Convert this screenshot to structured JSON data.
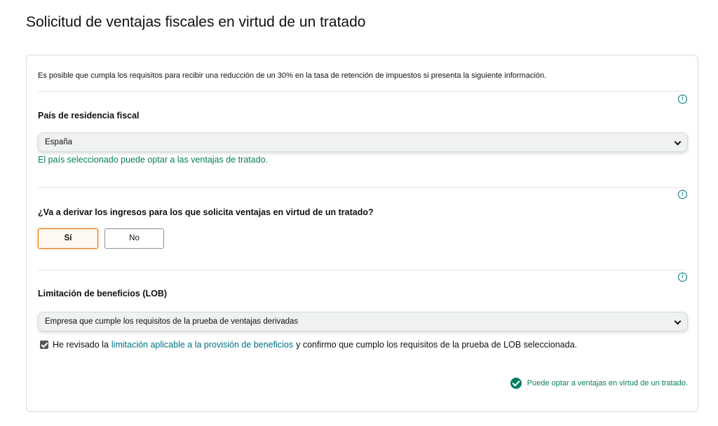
{
  "page": {
    "title": "Solicitud de ventajas fiscales en virtud de un tratado"
  },
  "card": {
    "intro": "Es posible que cumpla los requisitos para recibir una reducción de un 30% en la tasa de retención de impuestos si presenta la siguiente información."
  },
  "residence": {
    "label": "País de residencia fiscal",
    "selected": "España",
    "message": "El país seleccionado puede optar a las ventajas de tratado."
  },
  "derive": {
    "label": "¿Va a derivar los ingresos para los que solicita ventajas en virtud de un tratado?",
    "yes_label": "Sí",
    "no_label": "No",
    "selected": "Sí"
  },
  "lob": {
    "label": "Limitación de beneficios (LOB)",
    "selected": "Empresa que cumple los requisitos de la prueba de ventajas derivadas",
    "checkbox_checked": true,
    "checkbox_prefix": "He revisado la",
    "checkbox_link": "limitación aplicable a la provisión de beneficios",
    "checkbox_suffix": "y confirmo que cumplo los requisitos de la prueba de LOB seleccionada."
  },
  "eligibility": {
    "message": "Puede optar a ventajas en virtud de un tratado."
  },
  "icons": {
    "info": "info-icon",
    "check": "check-circle-icon",
    "chevron": "chevron-down-icon"
  },
  "colors": {
    "success": "#067d62",
    "link": "#007185",
    "selected_border": "#e77600"
  }
}
